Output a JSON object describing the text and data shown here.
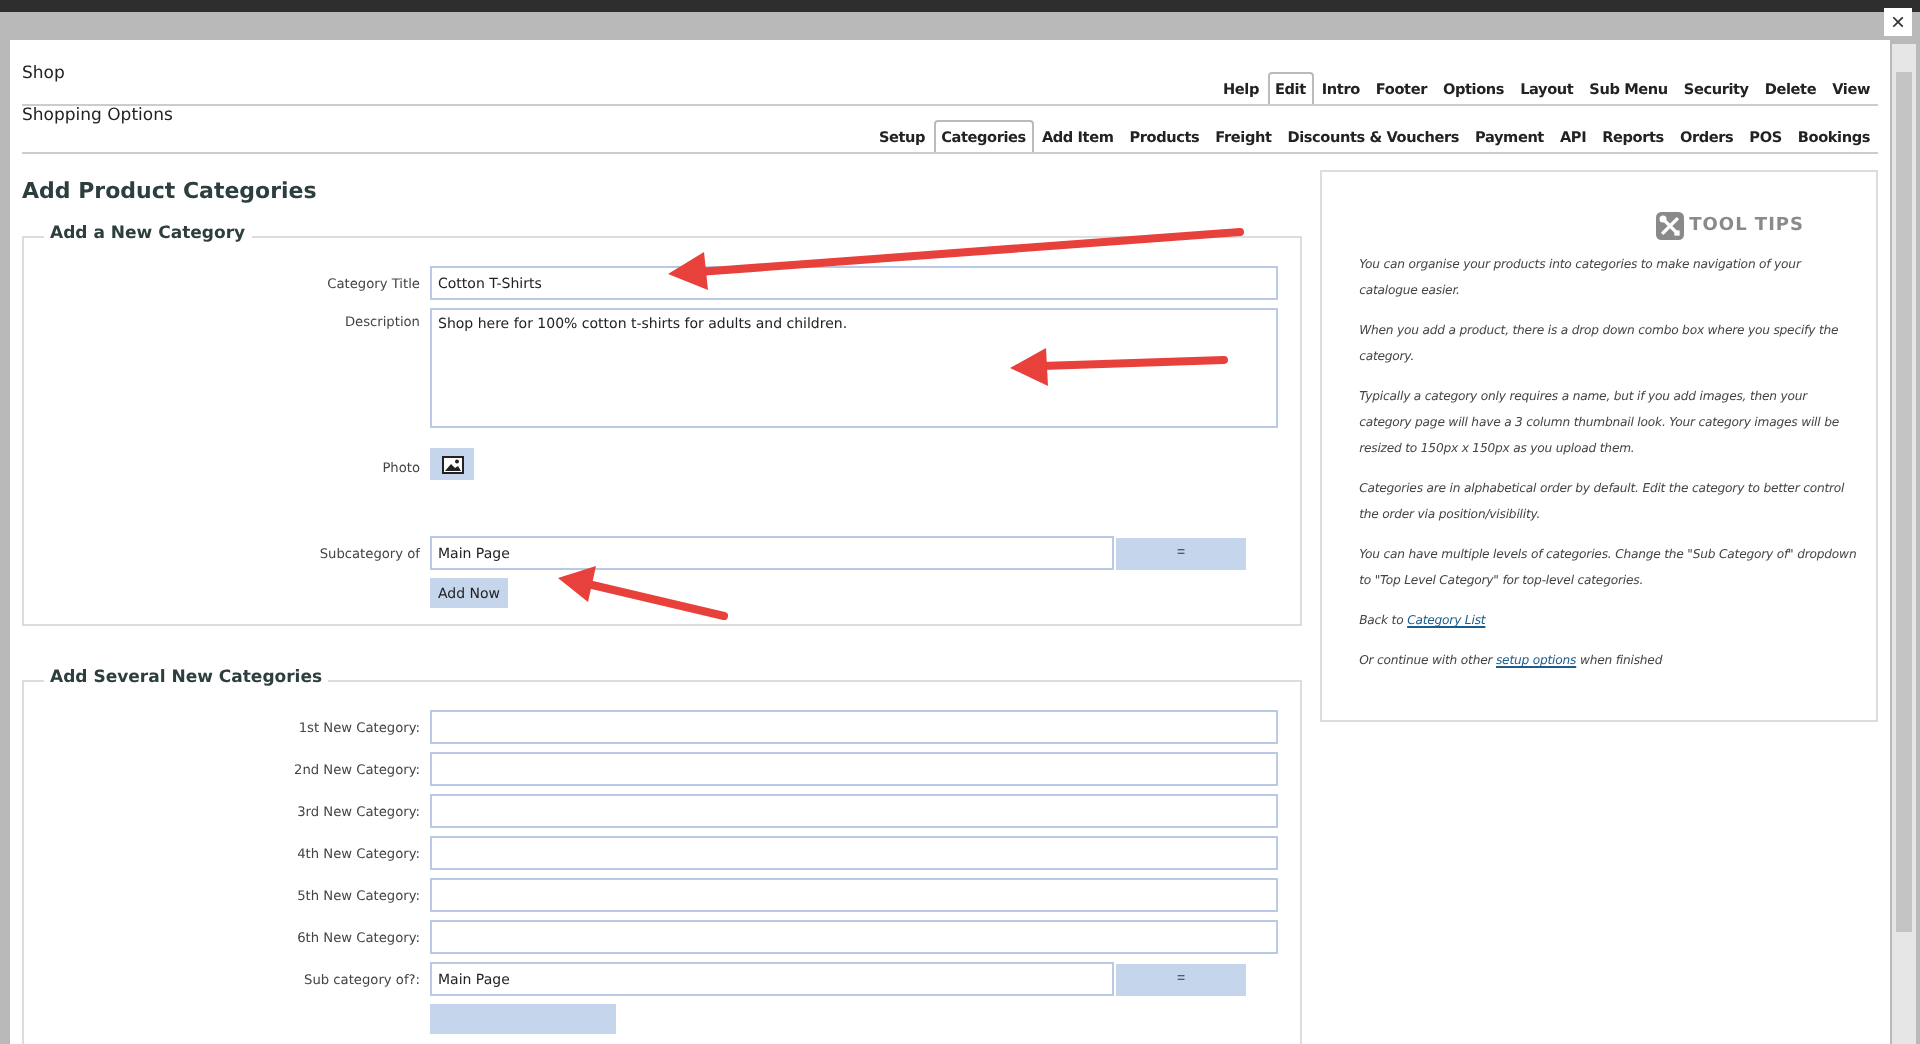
{
  "header": {
    "title": "Shop",
    "menu": [
      {
        "label": "Help",
        "selected": false
      },
      {
        "label": "Edit",
        "selected": true
      },
      {
        "label": "Intro",
        "selected": false
      },
      {
        "label": "Footer",
        "selected": false
      },
      {
        "label": "Options",
        "selected": false
      },
      {
        "label": "Layout",
        "selected": false
      },
      {
        "label": "Sub Menu",
        "selected": false
      },
      {
        "label": "Security",
        "selected": false
      },
      {
        "label": "Delete",
        "selected": false
      },
      {
        "label": "View",
        "selected": false
      }
    ]
  },
  "subheader": {
    "title": "Shopping Options",
    "tabs": [
      {
        "label": "Setup",
        "selected": false
      },
      {
        "label": "Categories",
        "selected": true
      },
      {
        "label": "Add Item",
        "selected": false
      },
      {
        "label": "Products",
        "selected": false
      },
      {
        "label": "Freight",
        "selected": false
      },
      {
        "label": "Discounts & Vouchers",
        "selected": false
      },
      {
        "label": "Payment",
        "selected": false
      },
      {
        "label": "API",
        "selected": false
      },
      {
        "label": "Reports",
        "selected": false
      },
      {
        "label": "Orders",
        "selected": false
      },
      {
        "label": "POS",
        "selected": false
      },
      {
        "label": "Bookings",
        "selected": false
      }
    ]
  },
  "page_title": "Add Product Categories",
  "new_category": {
    "legend": "Add a New Category",
    "title_label": "Category Title",
    "title_value": "Cotton T-Shirts",
    "description_label": "Description",
    "description_value": "Shop here for 100% cotton t-shirts for adults and children.",
    "photo_label": "Photo",
    "subcategory_label": "Subcategory of",
    "subcategory_value": "Main Page",
    "dropdown_button": "=",
    "submit": "Add Now"
  },
  "several": {
    "legend": "Add Several New Categories",
    "fields": [
      {
        "label": "1st New Category:"
      },
      {
        "label": "2nd New Category:"
      },
      {
        "label": "3rd New Category:"
      },
      {
        "label": "4th New Category:"
      },
      {
        "label": "5th New Category:"
      },
      {
        "label": "6th New Category:"
      }
    ],
    "subcategory_label": "Sub category of?:",
    "subcategory_value": "Main Page",
    "dropdown_button": "="
  },
  "tool_tips": {
    "heading": "TOOL TIPS",
    "paragraphs": [
      "You can organise your products into categories to make navigation of your catalogue easier.",
      "When you add a product, there is a drop down combo box where you specify the category.",
      "Typically a category only requires a name, but if you add images, then your category page will have a 3 column thumbnail look. Your category images will be resized to 150px x 150px as you upload them.",
      "Categories are in alphabetical order by default. Edit the category to better control the order via position/visibility.",
      "You can have multiple levels of categories. Change the \"Sub Category of\" dropdown to \"Top Level Category\" for top-level categories."
    ],
    "back": {
      "before": "Back to",
      "link": "Category List"
    },
    "continue": {
      "before": "Or continue with other",
      "link": "setup options",
      "after": "when finished"
    }
  },
  "close_button": "×"
}
